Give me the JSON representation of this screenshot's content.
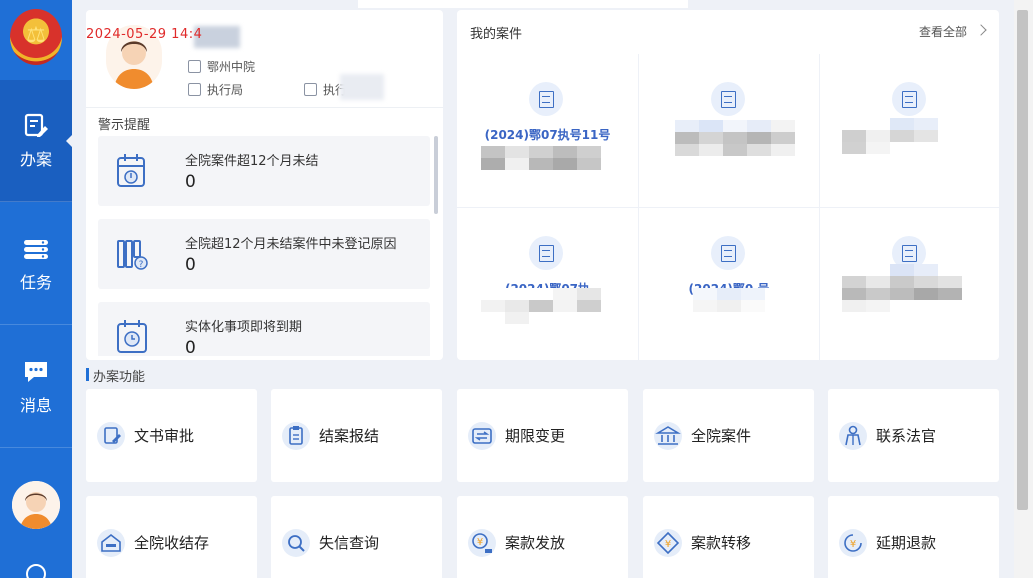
{
  "watermark": "2024-05-29 14:4",
  "sidebar": {
    "items": [
      {
        "label": "办案",
        "icon": "case-edit-icon",
        "active": true
      },
      {
        "label": "任务",
        "icon": "task-list-icon",
        "active": false
      },
      {
        "label": "消息",
        "icon": "message-icon",
        "active": false
      }
    ]
  },
  "profile": {
    "court": "鄂州中院",
    "department": "执行局",
    "role_prefix": "执行"
  },
  "alerts": {
    "title": "警示提醒",
    "items": [
      {
        "label": "全院案件超12个月未结",
        "count": "0",
        "icon": "calendar-clock-icon"
      },
      {
        "label": "全院超12个月未结案件中未登记原因",
        "count": "0",
        "icon": "books-question-icon"
      },
      {
        "label": "实体化事项即将到期",
        "count": "0",
        "icon": "calendar-timer-icon"
      }
    ]
  },
  "cases": {
    "title": "我的案件",
    "view_all": "查看全部",
    "items": [
      {
        "number": "(2024)鄂07执号11号"
      },
      {
        "number": "(2024)鄂0         9号"
      },
      {
        "number": "(2024)鄂0         号"
      },
      {
        "number": "(2024)鄂07执"
      },
      {
        "number": "(2024)鄂0         号"
      },
      {
        "number": "(2024)鄂0"
      }
    ]
  },
  "functions": {
    "title": "办案功能",
    "items": [
      {
        "label": "文书审批",
        "icon": "document-approve-icon"
      },
      {
        "label": "结案报结",
        "icon": "clipboard-icon"
      },
      {
        "label": "期限变更",
        "icon": "date-change-icon"
      },
      {
        "label": "全院案件",
        "icon": "courthouse-icon"
      },
      {
        "label": "联系法官",
        "icon": "judge-contact-icon"
      },
      {
        "label": "全院收结存",
        "icon": "inbox-home-icon"
      },
      {
        "label": "失信查询",
        "icon": "search-icon"
      },
      {
        "label": "案款发放",
        "icon": "money-disburse-icon"
      },
      {
        "label": "案款转移",
        "icon": "money-transfer-icon"
      },
      {
        "label": "延期退款",
        "icon": "refund-delay-icon"
      }
    ]
  },
  "colors": {
    "sidebar": "#1f6fd6",
    "accent": "#3a65c4",
    "watermark": "#e02a2a"
  }
}
